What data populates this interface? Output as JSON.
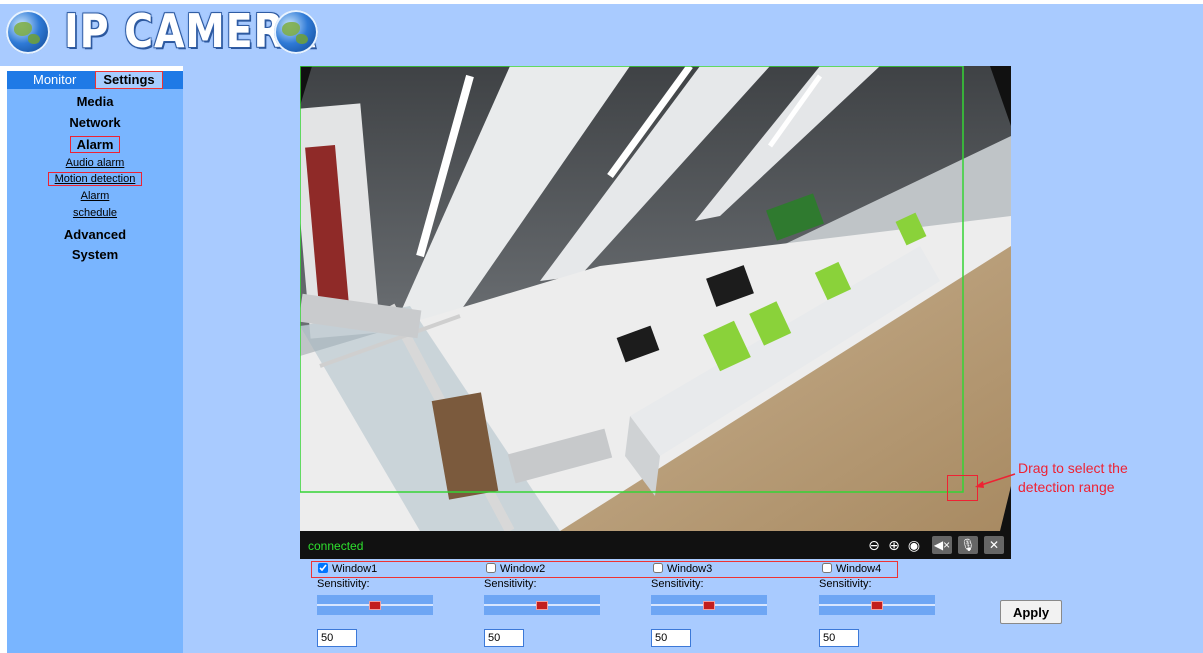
{
  "header": {
    "title": "IP CAMERA"
  },
  "sidebar": {
    "tabs": {
      "monitor": "Monitor",
      "settings": "Settings"
    },
    "menu": {
      "media": "Media",
      "network": "Network",
      "alarm": "Alarm",
      "audio_alarm": "Audio alarm",
      "motion_detection": "Motion detection",
      "alarm_schedule_1": "Alarm",
      "alarm_schedule_2": "schedule",
      "advanced": "Advanced",
      "system": "System"
    }
  },
  "video": {
    "status": "connected",
    "controls": [
      "zoom-out-icon",
      "zoom-in-icon",
      "record-icon",
      "mute-icon",
      "mic-off-icon",
      "tools-icon"
    ]
  },
  "windows": [
    {
      "label": "Window1",
      "checked": true,
      "sensitivity_label": "Sensitivity:",
      "sensitivity": "50"
    },
    {
      "label": "Window2",
      "checked": false,
      "sensitivity_label": "Sensitivity:",
      "sensitivity": "50"
    },
    {
      "label": "Window3",
      "checked": false,
      "sensitivity_label": "Sensitivity:",
      "sensitivity": "50"
    },
    {
      "label": "Window4",
      "checked": false,
      "sensitivity_label": "Sensitivity:",
      "sensitivity": "50"
    }
  ],
  "apply_label": "Apply",
  "annotation": {
    "line1": "Drag to select the",
    "line2": "detection range"
  },
  "colors": {
    "accent_red": "#e23333",
    "panel_blue": "#a9cbff",
    "sidebar_blue": "#79b5ff",
    "status_green": "#2ee02e",
    "detection_green": "#35d435"
  }
}
